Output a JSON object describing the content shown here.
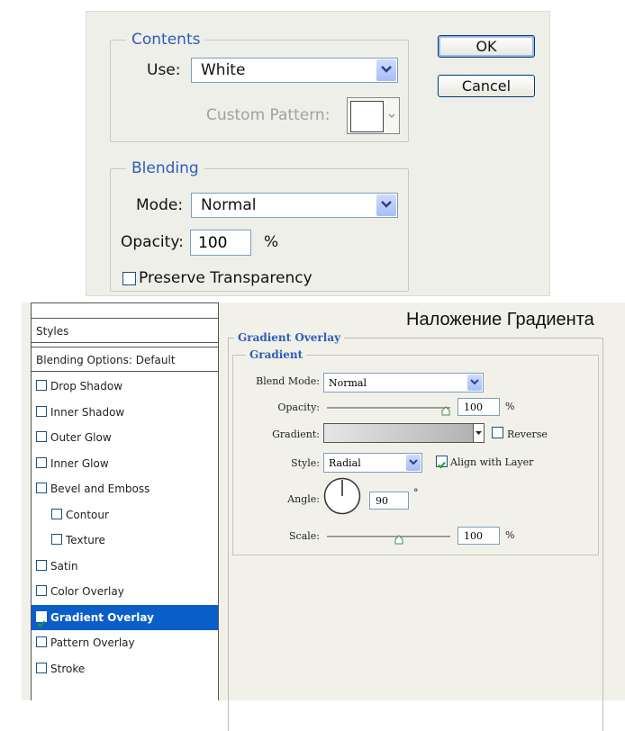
{
  "fill_dialog": {
    "contents": {
      "title": "Contents",
      "use_label": "Use:",
      "use_value": "White",
      "custom_pattern_label": "Custom Pattern:"
    },
    "buttons": {
      "ok": "OK",
      "cancel": "Cancel"
    },
    "blending": {
      "title": "Blending",
      "mode_label": "Mode:",
      "mode_value": "Normal",
      "opacity_label": "Opacity:",
      "opacity_value": "100",
      "opacity_unit": "%",
      "preserve_label": "Preserve Transparency",
      "preserve_checked": false
    }
  },
  "layer_style": {
    "caption": "Наложение Градиента",
    "styles_header": "Styles",
    "blending_options": "Blending Options: Default",
    "items": [
      {
        "label": "Drop Shadow",
        "checked": false
      },
      {
        "label": "Inner Shadow",
        "checked": false
      },
      {
        "label": "Outer Glow",
        "checked": false
      },
      {
        "label": "Inner Glow",
        "checked": false
      },
      {
        "label": "Bevel and Emboss",
        "checked": false
      },
      {
        "label": "Contour",
        "checked": false
      },
      {
        "label": "Texture",
        "checked": false
      },
      {
        "label": "Satin",
        "checked": false
      },
      {
        "label": "Color Overlay",
        "checked": false
      },
      {
        "label": "Gradient Overlay",
        "checked": true
      },
      {
        "label": "Pattern Overlay",
        "checked": false
      },
      {
        "label": "Stroke",
        "checked": false
      }
    ],
    "gradient_overlay": {
      "title": "Gradient Overlay",
      "group_title": "Gradient",
      "blend_mode_label": "Blend Mode:",
      "blend_mode_value": "Normal",
      "opacity_label": "Opacity:",
      "opacity_value": "100",
      "opacity_unit": "%",
      "opacity_level": 1.0,
      "gradient_label": "Gradient:",
      "reverse_label": "Reverse",
      "reverse_checked": false,
      "style_label": "Style:",
      "style_value": "Radial",
      "align_label": "Align with Layer",
      "align_checked": true,
      "angle_label": "Angle:",
      "angle_value": "90",
      "angle_unit": "°",
      "scale_label": "Scale:",
      "scale_value": "100",
      "scale_unit": "%"
    }
  },
  "colors": {
    "accent_blue": "#2e5db6",
    "selection_blue": "#0a5ec9",
    "dialog_bg": "#efefe9"
  }
}
